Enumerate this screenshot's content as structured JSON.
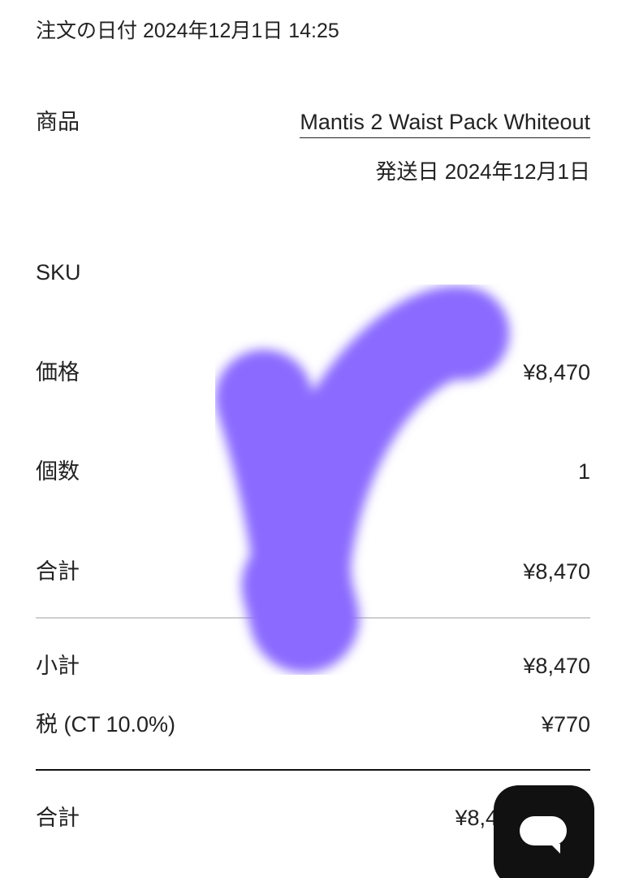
{
  "order": {
    "date_text": "注文の日付 2024年12月1日 14:25"
  },
  "item": {
    "product_label": "商品",
    "product_name": "Mantis 2 Waist Pack Whiteout",
    "ship_date_text": "発送日 2024年12月1日",
    "sku_label": "SKU",
    "sku_value": "",
    "price_label": "価格",
    "price_value": "¥8,470",
    "quantity_label": "個数",
    "quantity_value": "1",
    "total_label": "合計",
    "total_value": "¥8,470"
  },
  "summary": {
    "subtotal_label": "小計",
    "subtotal_value": "¥8,470",
    "tax_label": "税 (CT 10.0%)",
    "tax_value": "¥770",
    "grand_total_label": "合計",
    "grand_total_value": "¥8,4"
  },
  "overlays": {
    "logo_icon": "brand-swoosh-icon",
    "logo_color": "#8a6bff",
    "chat_icon": "chat-bubble-icon",
    "chat_bg": "#111111"
  }
}
